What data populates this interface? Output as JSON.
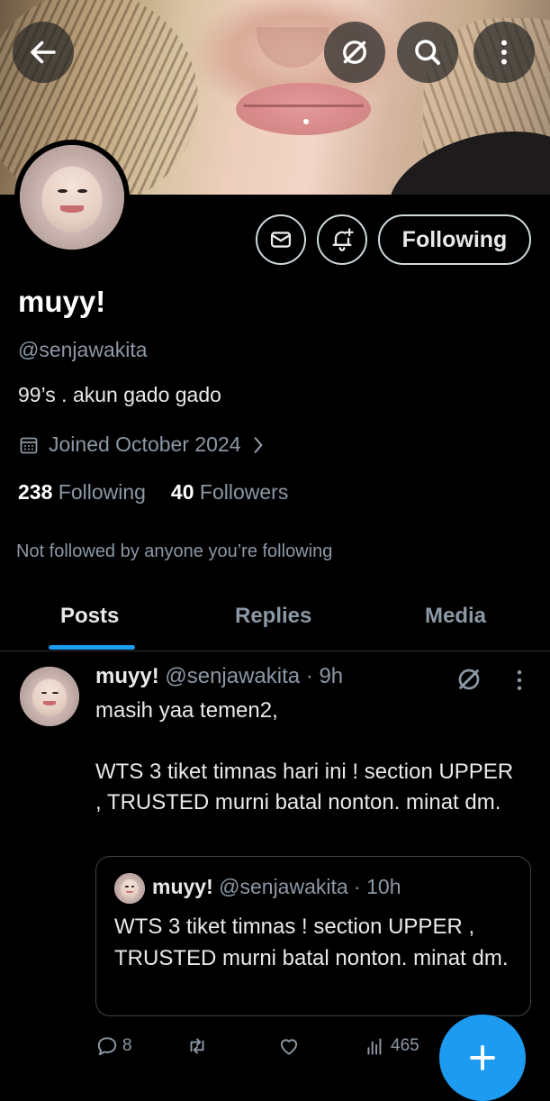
{
  "header": {
    "back_icon": "arrow-left-icon",
    "grok_icon": "grok-slash-icon",
    "search_icon": "search-icon",
    "more_icon": "more-vertical-icon"
  },
  "profile": {
    "display_name": "muyy!",
    "handle": "@senjawakita",
    "bio": "99’s . akun gado gado",
    "joined": "Joined October 2024",
    "following_count": "238",
    "following_label": "Following",
    "followers_count": "40",
    "followers_label": "Followers",
    "not_followed_note": "Not followed by anyone you’re following",
    "following_button": "Following"
  },
  "tabs": [
    {
      "label": "Posts",
      "active": true
    },
    {
      "label": "Replies",
      "active": false
    },
    {
      "label": "Media",
      "active": false
    }
  ],
  "post": {
    "author_name": "muyy!",
    "meta": "@senjawakita · 9h",
    "text": "masih yaa temen2,\n\nWTS 3 tiket timnas hari ini ! section UPPER , TRUSTED murni batal nonton. minat dm.",
    "quote": {
      "author_name": "muyy!",
      "meta": "@senjawakita · 10h",
      "text": "WTS 3 tiket timnas ! section UPPER , TRUSTED murni batal nonton. minat dm."
    },
    "replies": "8",
    "reposts": "",
    "likes": "",
    "views": "465"
  },
  "colors": {
    "accent": "#1d9bf0",
    "background": "#000000",
    "muted_text": "#8b98a5"
  }
}
